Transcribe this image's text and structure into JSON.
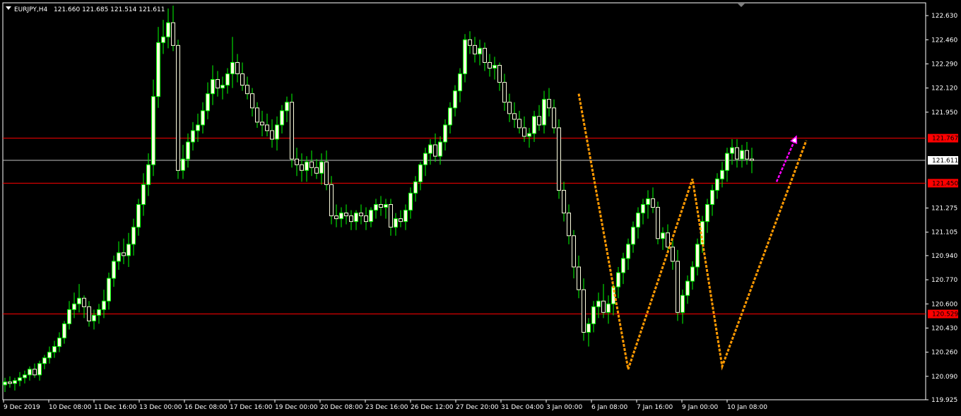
{
  "chart_data": {
    "type": "candlestick",
    "header": {
      "symbol_timeframe": "EURJPY,H4",
      "values_text": "121.660 121.685 121.514 121.611"
    },
    "ylim": [
      119.925,
      122.72
    ],
    "y_ticks": [
      "122.630",
      "122.460",
      "122.290",
      "122.120",
      "121.950",
      "121.275",
      "121.105",
      "120.940",
      "120.770",
      "120.600",
      "120.430",
      "120.260",
      "120.090",
      "119.925"
    ],
    "x_ticks": [
      "9 Dec 2019",
      "10 Dec 08:00",
      "11 Dec 16:00",
      "13 Dec 00:00",
      "16 Dec 08:00",
      "17 Dec 16:00",
      "19 Dec 00:00",
      "20 Dec 08:00",
      "23 Dec 16:00",
      "26 Dec 12:00",
      "27 Dec 20:00",
      "31 Dec 04:00",
      "3 Jan 00:00",
      "6 Jan 08:00",
      "7 Jan 16:00",
      "9 Jan 00:00",
      "10 Jan 08:00"
    ],
    "horizontal_levels": [
      {
        "value": 121.767,
        "label": "121.767",
        "color": "#ff0000",
        "label_bg": "#ff0000",
        "label_color": "#000000"
      },
      {
        "value": 121.45,
        "label": "121.450",
        "color": "#ff0000",
        "label_bg": "#ff0000",
        "label_color": "#000000"
      },
      {
        "value": 120.529,
        "label": "120.529",
        "color": "#ff0000",
        "label_bg": "#ff0000",
        "label_color": "#000000"
      },
      {
        "value": 121.611,
        "label": "121.611",
        "color": "#c0c0c0",
        "label_bg": "#ffffff",
        "label_color": "#000000"
      }
    ],
    "colors": {
      "background": "#000000",
      "bull_body": "#ffffe0",
      "wick": "#00ff00",
      "pattern_line": "#ff9900",
      "arrow": "#ff00ff",
      "axis_text": "#ffffff"
    },
    "w_pattern": [
      {
        "bar": 116,
        "price": 122.08
      },
      {
        "bar": 126,
        "price": 120.14
      },
      {
        "bar": 139,
        "price": 121.48
      },
      {
        "bar": 145,
        "price": 120.16
      },
      {
        "bar": 162,
        "price": 121.75
      }
    ],
    "arrow": {
      "from": {
        "bar": 156,
        "price": 121.46
      },
      "to": {
        "bar": 160,
        "price": 121.78
      }
    },
    "candles": [
      [
        120.03,
        120.08,
        119.98,
        120.05
      ],
      [
        120.05,
        120.09,
        120.01,
        120.04
      ],
      [
        120.04,
        120.08,
        119.99,
        120.06
      ],
      [
        120.06,
        120.12,
        120.02,
        120.08
      ],
      [
        120.08,
        120.13,
        120.04,
        120.1
      ],
      [
        120.1,
        120.16,
        120.06,
        120.14
      ],
      [
        120.14,
        120.18,
        120.08,
        120.1
      ],
      [
        120.1,
        120.2,
        120.06,
        120.18
      ],
      [
        120.18,
        120.24,
        120.14,
        120.22
      ],
      [
        120.22,
        120.3,
        120.18,
        120.26
      ],
      [
        120.26,
        120.34,
        120.22,
        120.3
      ],
      [
        120.3,
        120.4,
        120.26,
        120.36
      ],
      [
        120.36,
        120.48,
        120.32,
        120.46
      ],
      [
        120.46,
        120.62,
        120.42,
        120.56
      ],
      [
        120.56,
        120.68,
        120.5,
        120.6
      ],
      [
        120.6,
        120.74,
        120.54,
        120.64
      ],
      [
        120.64,
        120.66,
        120.5,
        120.58
      ],
      [
        120.58,
        120.62,
        120.44,
        120.48
      ],
      [
        120.48,
        120.56,
        120.42,
        120.52
      ],
      [
        120.52,
        120.6,
        120.46,
        120.56
      ],
      [
        120.56,
        120.7,
        120.5,
        120.62
      ],
      [
        120.62,
        120.82,
        120.56,
        120.78
      ],
      [
        120.78,
        120.94,
        120.72,
        120.9
      ],
      [
        120.9,
        121.04,
        120.84,
        120.96
      ],
      [
        120.96,
        121.06,
        120.88,
        120.94
      ],
      [
        120.94,
        121.1,
        120.86,
        121.02
      ],
      [
        121.02,
        121.2,
        120.94,
        121.14
      ],
      [
        121.14,
        121.34,
        121.08,
        121.3
      ],
      [
        121.3,
        121.52,
        121.22,
        121.44
      ],
      [
        121.44,
        121.66,
        121.36,
        121.58
      ],
      [
        121.58,
        122.18,
        121.5,
        122.06
      ],
      [
        122.06,
        122.55,
        121.98,
        122.44
      ],
      [
        122.44,
        122.6,
        122.36,
        122.48
      ],
      [
        122.48,
        122.68,
        122.4,
        122.58
      ],
      [
        122.58,
        122.7,
        122.38,
        122.42
      ],
      [
        122.42,
        122.46,
        121.48,
        121.54
      ],
      [
        121.54,
        121.72,
        121.48,
        121.62
      ],
      [
        121.62,
        121.8,
        121.56,
        121.74
      ],
      [
        121.74,
        121.88,
        121.68,
        121.82
      ],
      [
        121.82,
        121.94,
        121.74,
        121.86
      ],
      [
        121.86,
        122.02,
        121.8,
        121.96
      ],
      [
        121.96,
        122.16,
        121.9,
        122.08
      ],
      [
        122.08,
        122.28,
        122.0,
        122.18
      ],
      [
        122.18,
        122.24,
        122.06,
        122.12
      ],
      [
        122.12,
        122.2,
        122.04,
        122.14
      ],
      [
        122.14,
        122.26,
        122.08,
        122.22
      ],
      [
        122.22,
        122.48,
        122.12,
        122.3
      ],
      [
        122.3,
        122.36,
        122.16,
        122.22
      ],
      [
        122.22,
        122.3,
        122.1,
        122.14
      ],
      [
        122.14,
        122.2,
        122.04,
        122.08
      ],
      [
        122.08,
        122.12,
        121.92,
        121.98
      ],
      [
        121.98,
        122.02,
        121.84,
        121.88
      ],
      [
        121.88,
        121.96,
        121.78,
        121.86
      ],
      [
        121.86,
        121.94,
        121.78,
        121.82
      ],
      [
        121.82,
        121.9,
        121.7,
        121.76
      ],
      [
        121.76,
        121.92,
        121.68,
        121.86
      ],
      [
        121.86,
        122.0,
        121.8,
        121.96
      ],
      [
        121.96,
        122.06,
        121.88,
        122.02
      ],
      [
        122.02,
        122.08,
        121.56,
        121.62
      ],
      [
        121.62,
        121.7,
        121.5,
        121.58
      ],
      [
        121.58,
        121.66,
        121.46,
        121.54
      ],
      [
        121.54,
        121.64,
        121.46,
        121.6
      ],
      [
        121.6,
        121.68,
        121.5,
        121.56
      ],
      [
        121.56,
        121.62,
        121.48,
        121.52
      ],
      [
        121.52,
        121.66,
        121.44,
        121.6
      ],
      [
        121.6,
        121.68,
        121.4,
        121.44
      ],
      [
        121.44,
        121.5,
        121.16,
        121.22
      ],
      [
        121.22,
        121.3,
        121.14,
        121.2
      ],
      [
        121.2,
        121.28,
        121.14,
        121.24
      ],
      [
        121.24,
        121.3,
        121.16,
        121.22
      ],
      [
        121.22,
        121.26,
        121.12,
        121.18
      ],
      [
        121.18,
        121.26,
        121.12,
        121.24
      ],
      [
        121.24,
        121.3,
        121.16,
        121.22
      ],
      [
        121.22,
        121.28,
        121.12,
        121.18
      ],
      [
        121.18,
        121.28,
        121.14,
        121.26
      ],
      [
        121.26,
        121.34,
        121.2,
        121.3
      ],
      [
        121.3,
        121.36,
        121.22,
        121.28
      ],
      [
        121.28,
        121.34,
        121.2,
        121.3
      ],
      [
        121.3,
        121.34,
        121.08,
        121.14
      ],
      [
        121.14,
        121.24,
        121.08,
        121.2
      ],
      [
        121.2,
        121.26,
        121.14,
        121.18
      ],
      [
        121.18,
        121.3,
        121.12,
        121.26
      ],
      [
        121.26,
        121.42,
        121.2,
        121.38
      ],
      [
        121.38,
        121.5,
        121.32,
        121.46
      ],
      [
        121.46,
        121.6,
        121.4,
        121.58
      ],
      [
        121.58,
        121.7,
        121.5,
        121.66
      ],
      [
        121.66,
        121.76,
        121.58,
        121.72
      ],
      [
        121.72,
        121.8,
        121.6,
        121.64
      ],
      [
        121.64,
        121.78,
        121.58,
        121.74
      ],
      [
        121.74,
        121.9,
        121.68,
        121.86
      ],
      [
        121.86,
        122.02,
        121.8,
        121.98
      ],
      [
        121.98,
        122.14,
        121.92,
        122.1
      ],
      [
        122.1,
        122.26,
        122.02,
        122.22
      ],
      [
        122.22,
        122.5,
        122.16,
        122.46
      ],
      [
        122.46,
        122.52,
        122.36,
        122.42
      ],
      [
        122.42,
        122.48,
        122.3,
        122.36
      ],
      [
        122.36,
        122.46,
        122.28,
        122.4
      ],
      [
        122.4,
        122.44,
        122.24,
        122.3
      ],
      [
        122.3,
        122.36,
        122.2,
        122.26
      ],
      [
        122.26,
        122.34,
        122.18,
        122.28
      ],
      [
        122.28,
        122.3,
        122.1,
        122.16
      ],
      [
        122.16,
        122.22,
        121.96,
        122.02
      ],
      [
        122.02,
        122.08,
        121.88,
        121.94
      ],
      [
        121.94,
        122.02,
        121.84,
        121.9
      ],
      [
        121.9,
        121.96,
        121.8,
        121.84
      ],
      [
        121.84,
        121.92,
        121.74,
        121.78
      ],
      [
        121.78,
        121.84,
        121.7,
        121.8
      ],
      [
        121.8,
        121.96,
        121.74,
        121.92
      ],
      [
        121.92,
        122.0,
        121.82,
        121.86
      ],
      [
        121.86,
        122.1,
        121.8,
        122.04
      ],
      [
        122.04,
        122.12,
        121.92,
        121.98
      ],
      [
        121.98,
        122.04,
        121.8,
        121.84
      ],
      [
        121.84,
        121.9,
        121.34,
        121.4
      ],
      [
        121.4,
        121.46,
        121.18,
        121.24
      ],
      [
        121.24,
        121.3,
        121.02,
        121.08
      ],
      [
        121.08,
        121.12,
        120.78,
        120.86
      ],
      [
        120.86,
        120.94,
        120.64,
        120.7
      ],
      [
        120.7,
        120.78,
        120.34,
        120.4
      ],
      [
        120.4,
        120.5,
        120.3,
        120.46
      ],
      [
        120.46,
        120.62,
        120.4,
        120.58
      ],
      [
        120.58,
        120.68,
        120.5,
        120.62
      ],
      [
        120.62,
        120.74,
        120.5,
        120.54
      ],
      [
        120.54,
        120.66,
        120.46,
        120.6
      ],
      [
        120.6,
        120.76,
        120.52,
        120.72
      ],
      [
        120.72,
        120.86,
        120.64,
        120.82
      ],
      [
        120.82,
        120.96,
        120.74,
        120.92
      ],
      [
        120.92,
        121.06,
        120.84,
        121.02
      ],
      [
        121.02,
        121.18,
        120.96,
        121.14
      ],
      [
        121.14,
        121.28,
        121.06,
        121.24
      ],
      [
        121.24,
        121.34,
        121.16,
        121.3
      ],
      [
        121.3,
        121.4,
        121.2,
        121.34
      ],
      [
        121.34,
        121.42,
        121.24,
        121.28
      ],
      [
        121.28,
        121.32,
        121.02,
        121.06
      ],
      [
        121.06,
        121.14,
        120.98,
        121.1
      ],
      [
        121.1,
        121.16,
        120.96,
        121.0
      ],
      [
        121.0,
        121.06,
        120.84,
        120.9
      ],
      [
        120.9,
        120.98,
        120.48,
        120.54
      ],
      [
        120.54,
        120.7,
        120.46,
        120.66
      ],
      [
        120.66,
        120.8,
        120.6,
        120.76
      ],
      [
        120.76,
        120.9,
        120.7,
        120.86
      ],
      [
        120.86,
        121.06,
        120.8,
        121.02
      ],
      [
        121.02,
        121.22,
        120.96,
        121.18
      ],
      [
        121.18,
        121.34,
        121.1,
        121.3
      ],
      [
        121.3,
        121.44,
        121.22,
        121.4
      ],
      [
        121.4,
        121.52,
        121.34,
        121.48
      ],
      [
        121.48,
        121.6,
        121.42,
        121.54
      ],
      [
        121.54,
        121.7,
        121.46,
        121.66
      ],
      [
        121.66,
        121.76,
        121.58,
        121.7
      ],
      [
        121.7,
        121.76,
        121.56,
        121.62
      ],
      [
        121.62,
        121.72,
        121.56,
        121.68
      ],
      [
        121.68,
        121.74,
        121.58,
        121.62
      ],
      [
        121.62,
        121.7,
        121.52,
        121.61
      ]
    ]
  }
}
